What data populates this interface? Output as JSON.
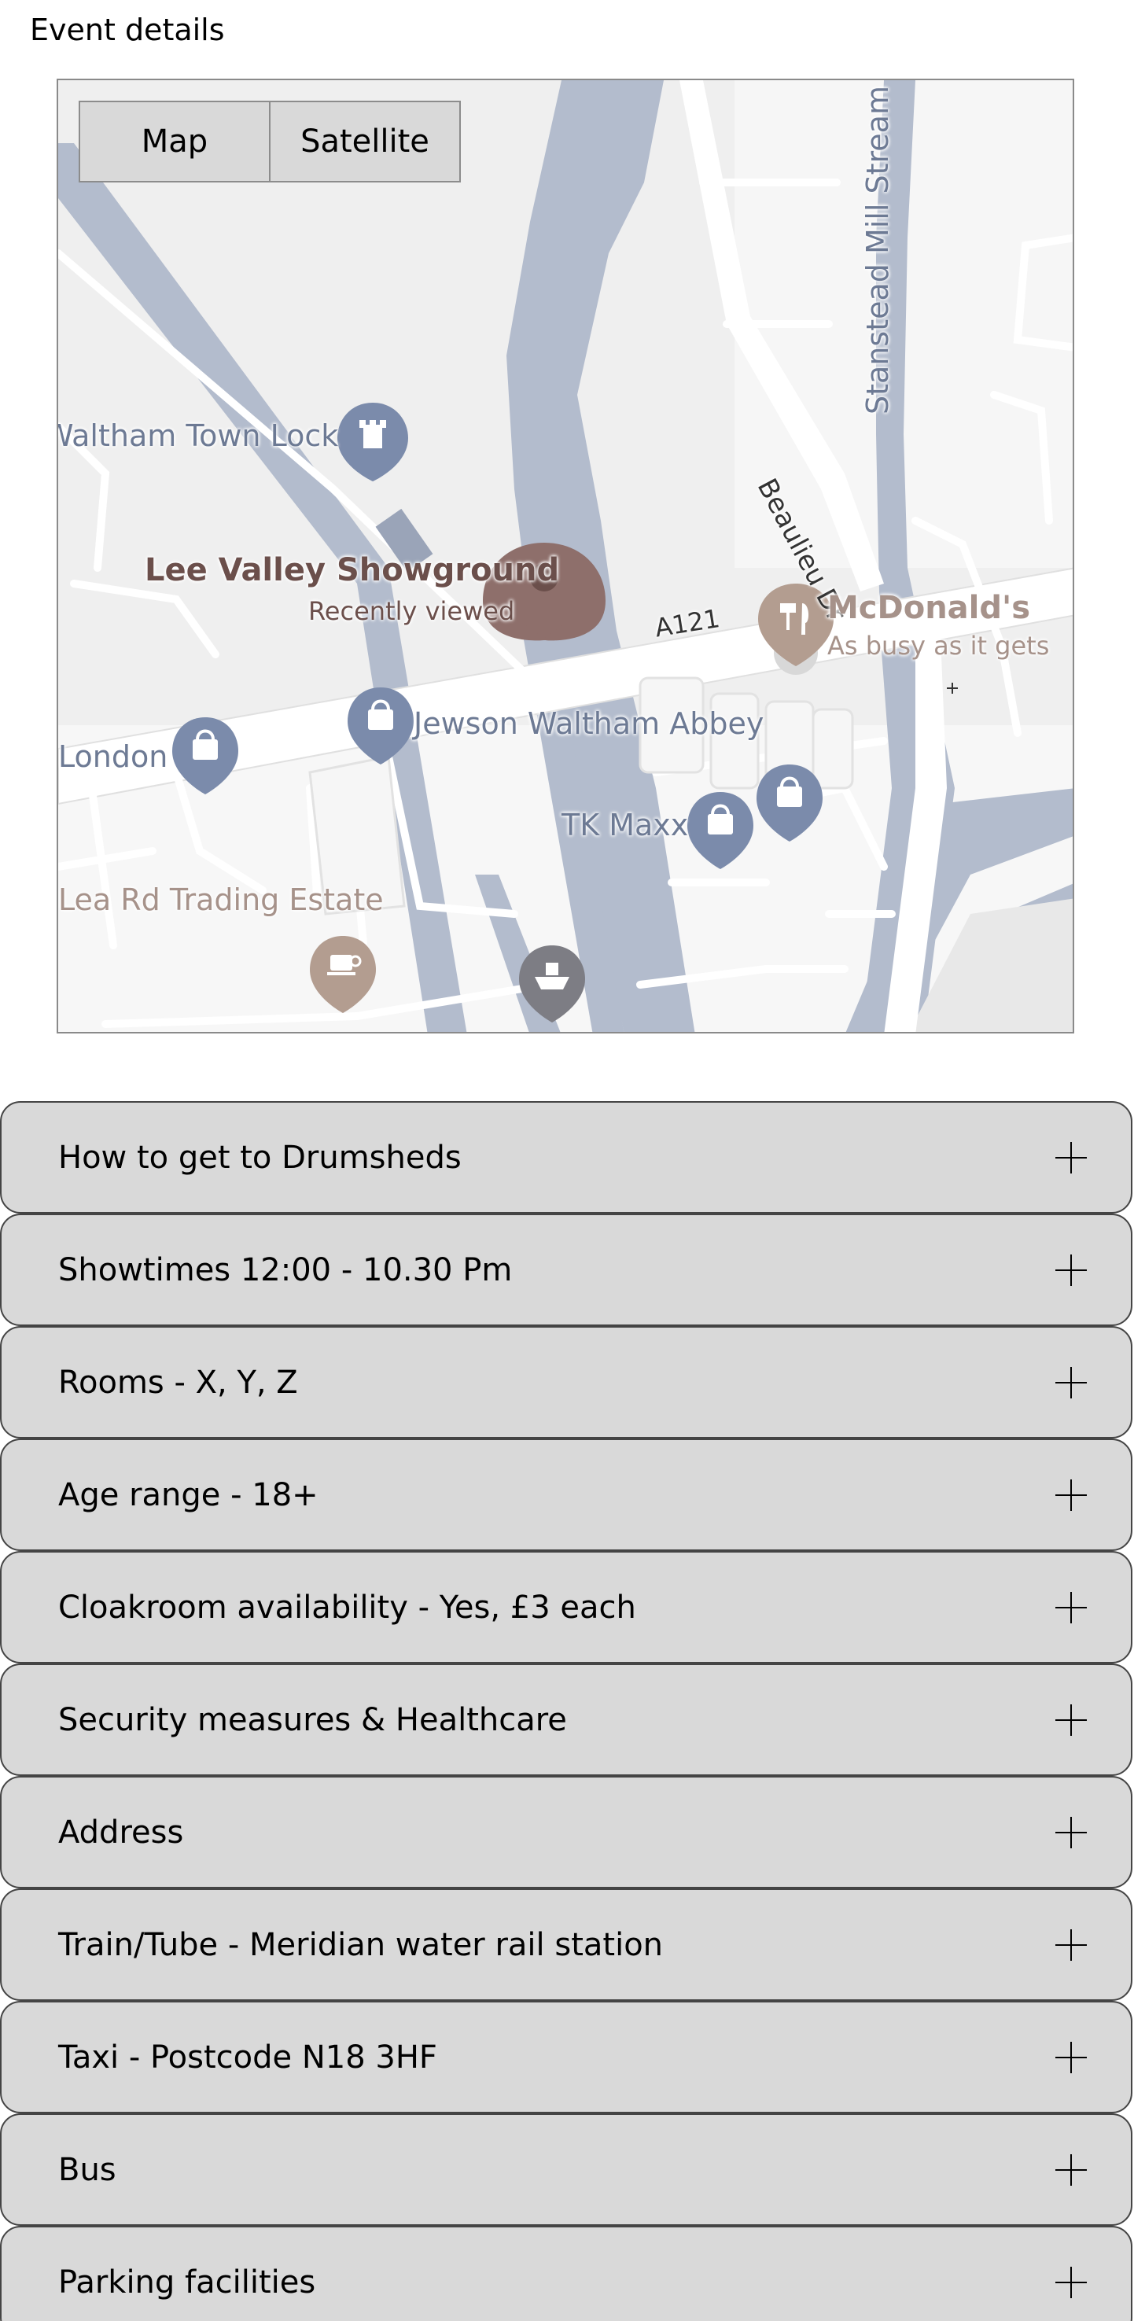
{
  "page": {
    "title": "Event details"
  },
  "map": {
    "toggle": {
      "map_label": "Map",
      "satellite_label": "Satellite",
      "selected": "Map"
    },
    "labels": {
      "waltham_town_lock": "Waltham Town Lock",
      "lee_valley": "Lee Valley Showground",
      "recently_viewed": "Recently viewed",
      "road_a121": "A121",
      "beaulieu_dr": "Beaulieu Dr",
      "stanstead_mill_stream": "Stanstead Mill Stream",
      "mcdonalds": "McDonald's",
      "mcdonalds_status": "As busy as it gets",
      "jewson": "Jewson Waltham Abbey",
      "london": "London",
      "tk_maxx": "TK Maxx",
      "lea_rd_trading": "Lea Rd Trading Estate"
    },
    "colors": {
      "land": "#f0f0f0",
      "water": "#b3bccd",
      "road": "#ffffff",
      "pin_selected": "#8e6f6b",
      "pin_blue": "#7b8bab",
      "pin_tan": "#b39d90",
      "pin_gray": "#7d7d84",
      "label_blue": "#6d7a94",
      "label_brown": "#6b4f4b",
      "label_tan": "#a6928a"
    }
  },
  "accordion": {
    "items": [
      {
        "label": "How to get to Drumsheds"
      },
      {
        "label": "Showtimes 12:00 - 10.30 Pm"
      },
      {
        "label": "Rooms - X, Y, Z"
      },
      {
        "label": "Age range - 18+"
      },
      {
        "label": "Cloakroom availability - Yes, £3 each"
      },
      {
        "label": "Security measures & Healthcare"
      },
      {
        "label": "Address"
      },
      {
        "label": "Train/Tube - Meridian water rail station"
      },
      {
        "label": "Taxi - Postcode N18 3HF"
      },
      {
        "label": "Bus"
      },
      {
        "label": "Parking facilities"
      }
    ]
  }
}
